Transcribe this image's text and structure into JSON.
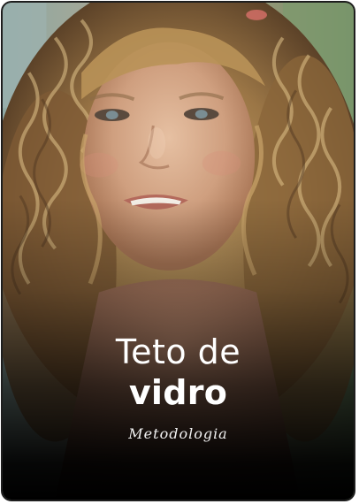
{
  "card": {
    "title_line1": "Teto de",
    "title_line2": "vidro",
    "subtitle": "Metodologia",
    "image_subject": "portrait of a child with long curly blond hair"
  },
  "colors": {
    "border": "#1e1e1e",
    "text": "#ffffff",
    "overlay": "#000000"
  }
}
